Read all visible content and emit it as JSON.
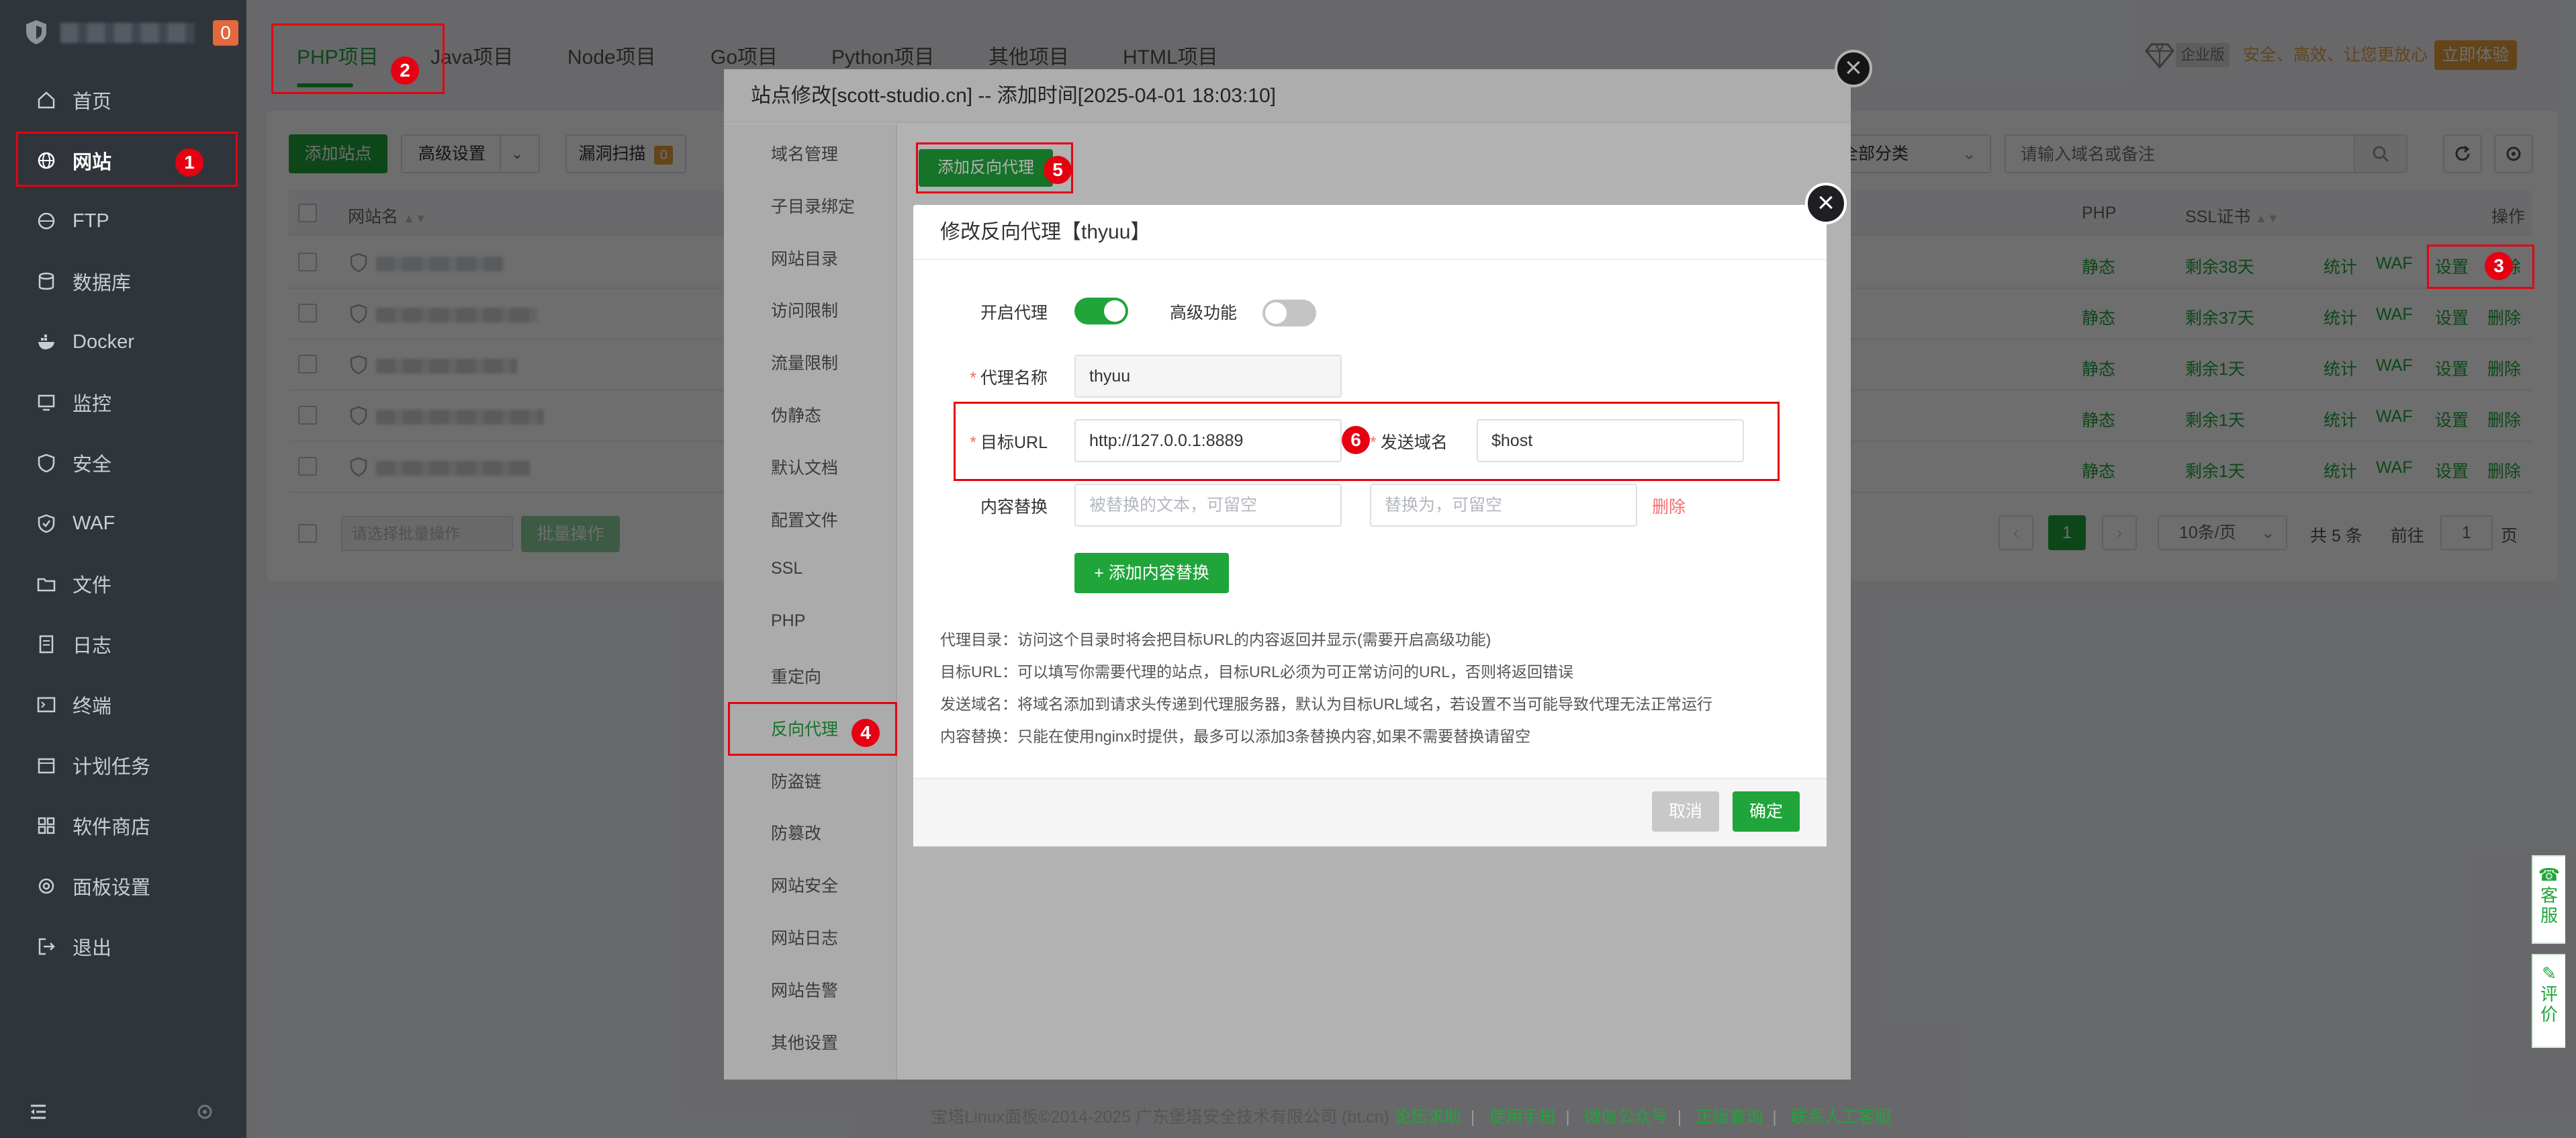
{
  "sidebar": {
    "badge": "0",
    "items": [
      {
        "label": "首页",
        "icon": "home-icon"
      },
      {
        "label": "网站",
        "icon": "globe-icon"
      },
      {
        "label": "FTP",
        "icon": "ftp-icon"
      },
      {
        "label": "数据库",
        "icon": "database-icon"
      },
      {
        "label": "Docker",
        "icon": "docker-icon"
      },
      {
        "label": "监控",
        "icon": "monitor-icon"
      },
      {
        "label": "安全",
        "icon": "shield-icon"
      },
      {
        "label": "WAF",
        "icon": "waf-shield-icon"
      },
      {
        "label": "文件",
        "icon": "folder-icon"
      },
      {
        "label": "日志",
        "icon": "log-icon"
      },
      {
        "label": "终端",
        "icon": "terminal-icon"
      },
      {
        "label": "计划任务",
        "icon": "calendar-icon"
      },
      {
        "label": "软件商店",
        "icon": "store-icon"
      },
      {
        "label": "面板设置",
        "icon": "gear-icon"
      },
      {
        "label": "退出",
        "icon": "logout-icon"
      }
    ]
  },
  "tabs": [
    "PHP项目",
    "Java项目",
    "Node项目",
    "Go项目",
    "Python项目",
    "其他项目",
    "HTML项目"
  ],
  "promo": {
    "ent_label": "企业版",
    "text": "安全、高效、让您更放心",
    "button": "立即体验"
  },
  "toolbar": {
    "add_site": "添加站点",
    "advanced": "高级设置",
    "vuln_scan": "漏洞扫描",
    "vuln_count": "0",
    "category": "全部分类",
    "search_placeholder": "请输入域名或备注"
  },
  "table": {
    "headers": {
      "name": "网站名",
      "php": "PHP",
      "ssl": "SSL证书",
      "ops": "操作"
    },
    "rows": [
      {
        "php": "静态",
        "ssl": "剩余38天"
      },
      {
        "php": "静态",
        "ssl": "剩余37天"
      },
      {
        "php": "静态",
        "ssl": "剩余1天"
      },
      {
        "php": "静态",
        "ssl": "剩余1天"
      },
      {
        "php": "静态",
        "ssl": "剩余1天"
      }
    ],
    "actions": {
      "stats": "统计",
      "waf": "WAF",
      "settings": "设置",
      "delete": "删除"
    },
    "batch_select_placeholder": "请选择批量操作",
    "batch_button": "批量操作"
  },
  "pagination": {
    "current": "1",
    "per_page": "10条/页",
    "total": "共 5 条",
    "goto_label": "前往",
    "goto_value": "1",
    "page_suffix": "页"
  },
  "site_dialog": {
    "title": "站点修改[scott-studio.cn] -- 添加时间[2025-04-01 18:03:10]",
    "menu": [
      "域名管理",
      "子目录绑定",
      "网站目录",
      "访问限制",
      "流量限制",
      "伪静态",
      "默认文档",
      "配置文件",
      "SSL",
      "PHP",
      "重定向",
      "反向代理",
      "防盗链",
      "防篡改",
      "网站安全",
      "网站日志",
      "网站告警",
      "其他设置"
    ],
    "add_proxy_button": "添加反向代理"
  },
  "proxy_dialog": {
    "title": "修改反向代理【thyuu】",
    "enable_label": "开启代理",
    "enable_on": true,
    "advanced_label": "高级功能",
    "advanced_on": false,
    "name_label": "代理名称",
    "name_value": "thyuu",
    "target_label": "目标URL",
    "target_value": "http://127.0.0.1:8889",
    "send_domain_label": "发送域名",
    "send_domain_value": "$host",
    "replace_label": "内容替换",
    "replace_from_placeholder": "被替换的文本，可留空",
    "replace_to_placeholder": "替换为，可留空",
    "replace_delete": "删除",
    "add_replace_button": "添加内容替换",
    "notes": [
      "代理目录：访问这个目录时将会把目标URL的内容返回并显示(需要开启高级功能)",
      "目标URL：可以填写你需要代理的站点，目标URL必须为可正常访问的URL，否则将返回错误",
      "发送域名：将域名添加到请求头传递到代理服务器，默认为目标URL域名，若设置不当可能导致代理无法正常运行",
      "内容替换：只能在使用nginx时提供，最多可以添加3条替换内容,如果不需要替换请留空"
    ],
    "cancel": "取消",
    "confirm": "确定"
  },
  "annotations": [
    "1",
    "2",
    "3",
    "4",
    "5",
    "6"
  ],
  "footer": {
    "copyright": "宝塔Linux面板©2014-2025 广东堡塔安全技术有限公司 (bt.cn)",
    "links": [
      "论坛求助",
      "使用手册",
      "微信公众号",
      "正版查询",
      "联系人工客服"
    ]
  },
  "side_tools": {
    "service": "客服",
    "review": "评价"
  },
  "colors": {
    "accent": "#20a53a",
    "sidebar_bg": "#30353b",
    "annotation_red": "#e60012",
    "warning": "#e6a23c",
    "danger": "#f56c6c"
  }
}
